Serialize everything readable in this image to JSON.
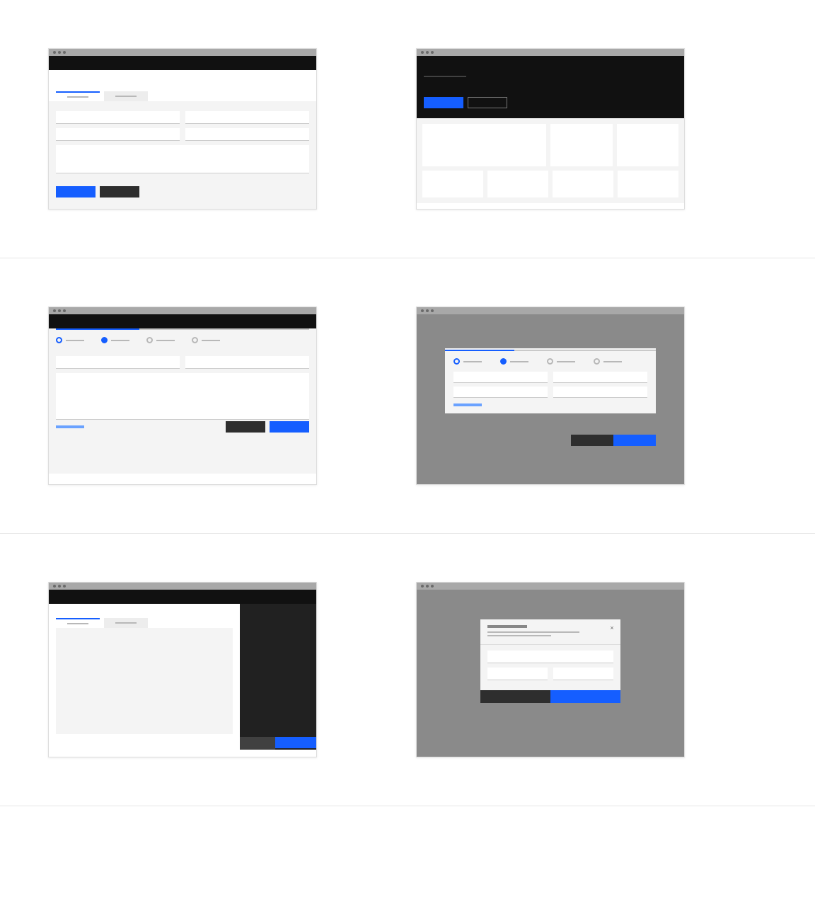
{
  "wireframes": [
    {
      "id": "tabbed-form",
      "type": "form-with-tabs",
      "tabs": [
        {
          "active": true
        },
        {
          "active": false
        }
      ],
      "fields": [
        [
          "text",
          "text"
        ],
        [
          "text",
          "text"
        ],
        [
          "textarea"
        ]
      ],
      "actions": [
        {
          "style": "primary"
        },
        {
          "style": "secondary"
        }
      ]
    },
    {
      "id": "media-library",
      "type": "hero-grid",
      "hero_actions": [
        {
          "style": "primary"
        },
        {
          "style": "ghost"
        }
      ],
      "grid": {
        "row1_cols": 3,
        "row2_cols": 4
      }
    },
    {
      "id": "wizard-page",
      "type": "progress-wizard",
      "progress_pct": 33,
      "steps": [
        {
          "state": "done"
        },
        {
          "state": "current"
        },
        {
          "state": "future"
        },
        {
          "state": "future"
        }
      ],
      "fields": [
        [
          "text",
          "text"
        ],
        [
          "textarea"
        ]
      ],
      "actions": {
        "link": true,
        "buttons": [
          {
            "style": "secondary"
          },
          {
            "style": "primary"
          }
        ]
      }
    },
    {
      "id": "wizard-modal",
      "type": "modal-wizard",
      "progress_pct": 33,
      "steps": [
        {
          "state": "done"
        },
        {
          "state": "current"
        },
        {
          "state": "future"
        },
        {
          "state": "future"
        }
      ],
      "fields": [
        [
          "text",
          "text"
        ],
        [
          "text",
          "text"
        ]
      ],
      "actions": {
        "link": true,
        "buttons": [
          {
            "style": "secondary"
          },
          {
            "style": "primary"
          }
        ]
      }
    },
    {
      "id": "side-panel",
      "type": "tabs-with-right-panel",
      "tabs": [
        {
          "active": true
        },
        {
          "active": false
        }
      ],
      "panel_actions": [
        {
          "style": "secondary"
        },
        {
          "style": "primary"
        }
      ]
    },
    {
      "id": "small-dialog",
      "type": "confirm-dialog",
      "has_close": true,
      "fields": [
        [
          "text"
        ],
        [
          "text",
          "text"
        ]
      ],
      "actions": [
        {
          "style": "secondary"
        },
        {
          "style": "primary"
        }
      ]
    }
  ],
  "colors": {
    "primary": "#155eff",
    "secondary": "#2e2e2e",
    "neutral_bg": "#f4f4f4",
    "window_chrome": "#a8a8a8",
    "topbar": "#111",
    "overlay": "#8a8a8a"
  }
}
